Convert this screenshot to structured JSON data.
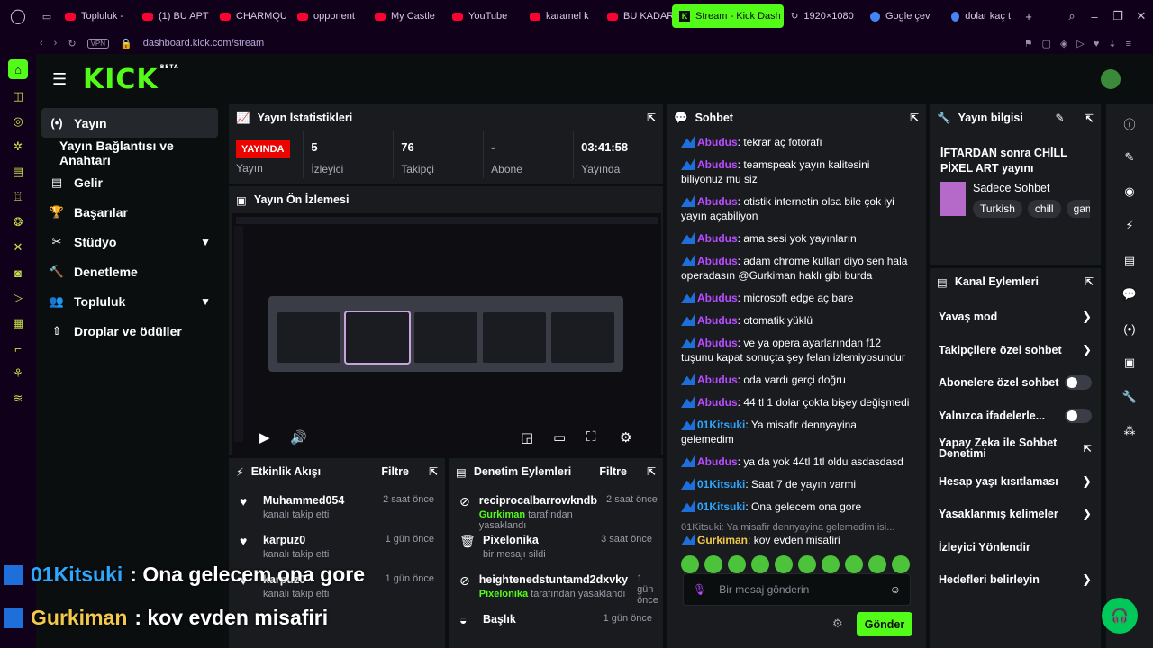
{
  "browser": {
    "tabs": [
      "Topluluk -",
      "(1) BU APT",
      "CHARMQU",
      "opponent",
      "My Castle",
      "YouTube",
      "karamel k",
      "BU KADAR",
      "Stream - Kick Dash",
      "1920×1080",
      "Gogle çev",
      "dolar kaç t"
    ],
    "active_tab": "Stream - Kick Dash",
    "vpn": "VPN",
    "url": "dashboard.kick.com/stream"
  },
  "brand": {
    "logo": "KICK",
    "beta": "BETA"
  },
  "nav": {
    "items": [
      {
        "icon": "(•)",
        "label": "Yayın"
      },
      {
        "icon": "",
        "label": "Yayın Bağlantısı ve Anahtarı"
      },
      {
        "icon": "▤",
        "label": "Gelir"
      },
      {
        "icon": "🏆",
        "label": "Başarılar"
      },
      {
        "icon": "✂",
        "label": "Stüdyo"
      },
      {
        "icon": "🔨",
        "label": "Denetleme"
      },
      {
        "icon": "👥",
        "label": "Topluluk"
      },
      {
        "icon": "⇧",
        "label": "Droplar ve ödüller"
      }
    ]
  },
  "stats": {
    "title": "Yayın İstatistikleri",
    "live": "YAYINDA",
    "live_label": "Yayın",
    "viewers": "5",
    "viewers_label": "İzleyici",
    "followers": "76",
    "followers_label": "Takipçi",
    "subs": "-",
    "subs_label": "Abone",
    "uptime": "03:41:58",
    "uptime_label": "Yayında"
  },
  "preview": {
    "title": "Yayın Ön İzlemesi"
  },
  "activity": {
    "title": "Etkinlik Akışı",
    "filter": "Filtre",
    "events": [
      {
        "name": "Muhammed054",
        "sub": "kanalı takip etti",
        "time": "2 saat önce"
      },
      {
        "name": "karpuz0",
        "sub": "kanalı takip etti",
        "time": "1 gün önce"
      },
      {
        "name": "karpuz0",
        "sub": "kanalı takip etti",
        "time": "1 gün önce"
      }
    ]
  },
  "moderation": {
    "title": "Denetim Eylemleri",
    "filter": "Filtre",
    "events": [
      {
        "name": "reciprocalbarrowkndb",
        "actor": "Gurkiman",
        "sub": "tarafından yasaklandı",
        "time": "2 saat önce"
      },
      {
        "name": "Pixelonika",
        "actor": "",
        "sub": "bir mesajı sildi",
        "time": "3 saat önce"
      },
      {
        "name": "heightenedstuntamd2dxvky",
        "actor": "Pixelonika",
        "sub": "tarafından yasaklandı",
        "time": "1 gün önce"
      },
      {
        "name": "Başlık",
        "actor": "",
        "sub": "",
        "time": "1 gün önce"
      }
    ]
  },
  "chat": {
    "title": "Sohbet",
    "messages": [
      {
        "user": "Abudus",
        "cls": "u-ab",
        "text": "tekrar aç fotorafı"
      },
      {
        "user": "Abudus",
        "cls": "u-ab",
        "text": "teamspeak yayın kalitesini biliyonuz mu siz"
      },
      {
        "user": "Abudus",
        "cls": "u-ab",
        "text": "otistik internetin olsa bile çok iyi yayın açabiliyon"
      },
      {
        "user": "Abudus",
        "cls": "u-ab",
        "text": "ama sesi yok yayınların"
      },
      {
        "user": "Abudus",
        "cls": "u-ab",
        "text": "adam chrome kullan diyo sen hala operadasın @Gurkiman haklı gibi burda"
      },
      {
        "user": "Abudus",
        "cls": "u-ab",
        "text": "microsoft edge aç bare"
      },
      {
        "user": "Abudus",
        "cls": "u-ab",
        "text": "otomatik yüklü"
      },
      {
        "user": "Abudus",
        "cls": "u-ab",
        "text": "ve ya opera ayarlarından f12 tuşunu kapat sonuçta şey felan izlemiyosundur"
      },
      {
        "user": "Abudus",
        "cls": "u-ab",
        "text": "oda vardı gerçi doğru"
      },
      {
        "user": "Abudus",
        "cls": "u-ab",
        "text": "44 tl 1 dolar çokta bişey değişmedi"
      },
      {
        "user": "01Kitsuki",
        "cls": "u-01",
        "text": "Ya misafir dennyayina gelemedim"
      },
      {
        "user": "Abudus",
        "cls": "u-ab",
        "text": "ya da yok 44tl 1tl oldu asdasdasd"
      },
      {
        "user": "01Kitsuki",
        "cls": "u-01",
        "text": "Saat 7 de yayın varmi"
      },
      {
        "user": "01Kitsuki",
        "cls": "u-01",
        "text": "Ona gelecem ona gore"
      }
    ],
    "reply_preview": "01Kitsuki: Ya misafir dennyayina gelemedim isi...",
    "last": {
      "user": "Gurkiman",
      "text": "kov evden misafiri"
    },
    "placeholder": "Bir mesaj gönderin",
    "send": "Gönder"
  },
  "stream_info": {
    "title": "Yayın bilgisi",
    "stream_title": "İFTARDAN sonra CHİLL PİXEL ART yayını",
    "category": "Sadece Sohbet",
    "tags": [
      "Turkish",
      "chill",
      "gam"
    ]
  },
  "channel_actions": {
    "title": "Kanal Eylemleri",
    "items": [
      {
        "label": "Yavaş mod",
        "kind": "arrow"
      },
      {
        "label": "Takipçilere özel sohbet",
        "kind": "arrow"
      },
      {
        "label": "Abonelere özel sohbet",
        "kind": "toggle"
      },
      {
        "label": "Yalnızca ifadelerle...",
        "kind": "toggle"
      },
      {
        "label": "Yapay Zeka ile Sohbet Denetimi",
        "kind": "link"
      },
      {
        "label": "Hesap yaşı kısıtlaması",
        "kind": "arrow"
      },
      {
        "label": "Yasaklanmış kelimeler",
        "kind": "arrow"
      },
      {
        "label": "İzleyici Yönlendir",
        "kind": "none"
      },
      {
        "label": "Hedefleri belirleyin",
        "kind": "arrow"
      }
    ]
  },
  "overlay": [
    {
      "user": "01Kitsuki",
      "text": ": Ona gelecem ona gore"
    },
    {
      "user": "Gurkiman",
      "text": ": kov evden misafiri"
    }
  ],
  "colors": {
    "brand": "#53fc18",
    "live": "#eb0400",
    "panel": "#191b1f",
    "bg": "#0b0e0f"
  }
}
